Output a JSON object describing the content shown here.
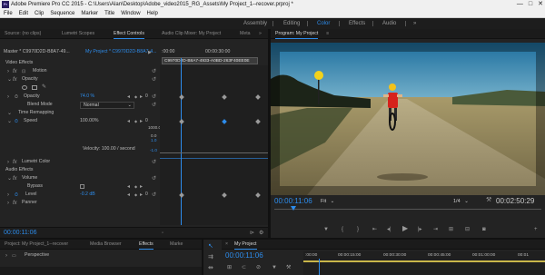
{
  "window": {
    "title": "Adobe Premiere Pro CC 2015 - C:\\Users\\Alan\\Desktop\\Adobe_video2015_RG_Assets\\My Project_1--recover.prproj *",
    "app_icon": "Pr",
    "controls": [
      "—",
      "□",
      "✕"
    ]
  },
  "menu": [
    "File",
    "Edit",
    "Clip",
    "Sequence",
    "Marker",
    "Title",
    "Window",
    "Help"
  ],
  "workspaces": {
    "tabs": [
      "Assembly",
      "Editing",
      "Color",
      "Effects",
      "Audio"
    ],
    "active": "Color",
    "more": "»"
  },
  "top_left_tabs": {
    "source": "Source: (no clips)",
    "lumetri_scopes": "Lumetri Scopes",
    "effect_controls": "Effect Controls",
    "audio_clip_mixer": "Audio Clip Mixer: My Project",
    "meta": "Meta",
    "more": "»"
  },
  "effect_controls": {
    "master_label": "Master * C9970D2D-B8A7-49...",
    "clip_label": "My Project * C9970D2D-B8A7-4...",
    "timecode_start": ":00:00",
    "timecode_mid": "00:00:30:00",
    "clip_bar": "C9970D2D-B8A7-4933-A0BD-263F40EE0E",
    "video_effects": "Video Effects",
    "motion": "Motion",
    "opacity": "Opacity",
    "opacity_prop": "Opacity",
    "opacity_value": "74.0 %",
    "blend_mode": "Blend Mode",
    "blend_value": "Normal",
    "time_remapping": "Time Remapping",
    "speed": "Speed",
    "speed_value": "100.00%",
    "graph_top": "1000.0",
    "graph_mid": "0.0",
    "graph_low": "1.0",
    "graph_bottom": "-1.0",
    "velocity": "Velocity: 100.00 / second",
    "lumetri_color": "Lumetri Color",
    "audio_effects": "Audio Effects",
    "volume": "Volume",
    "bypass": "Bypass",
    "level": "Level",
    "level_value": "-0.2 dB",
    "panner": "Panner",
    "zero": "0",
    "footer_timecode": "00:00:11:06"
  },
  "program_monitor": {
    "tab": "Program: My Project",
    "menu_icon": "≡",
    "timecode": "00:00:11:06",
    "fit": "Fit",
    "resolution": "1/4",
    "duration": "00:02:50:29"
  },
  "bottom": {
    "project_tab": "Project: My Project_1--recover",
    "media_browser": "Media Browser",
    "effects_tab": "Effects",
    "markers_tab": "Marke",
    "perspective": "Perspective",
    "sequence_tab": "My Project",
    "seq_timecode": "00:00:11:06",
    "ruler": [
      ":00:00",
      "00:00:15:00",
      "00:00:30:00",
      "00:00:45:00",
      "00:01:00:00",
      "00:01"
    ]
  },
  "colors": {
    "accent": "#2d8ceb",
    "panel_bg": "#232323",
    "header_bg": "#1b1b1b",
    "keyframe": "#9a9a9a"
  }
}
